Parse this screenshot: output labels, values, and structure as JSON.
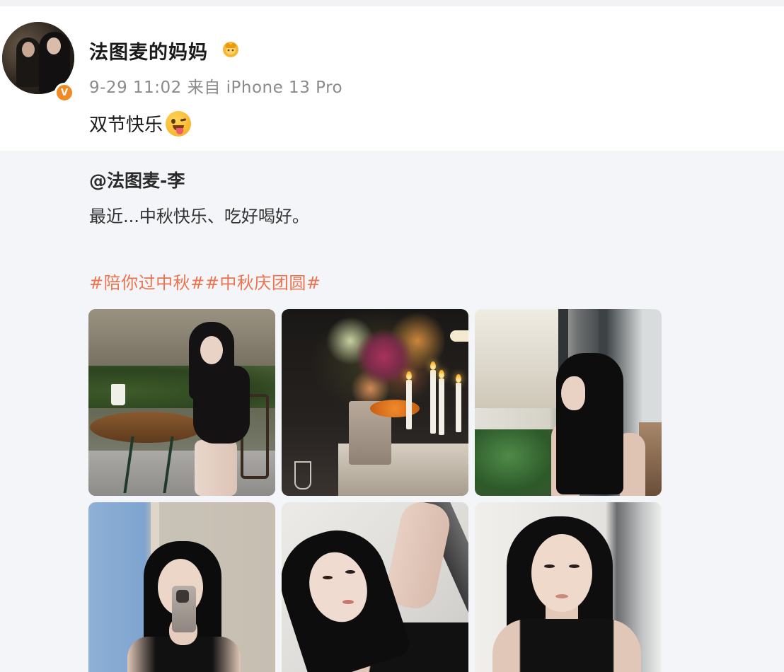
{
  "post": {
    "author_name": "法图麦的妈妈",
    "timestamp": "9-29 11:02",
    "source": "来自 iPhone 13 Pro",
    "text": "双节快乐",
    "emoji": "tongue-wink-emoji",
    "verified": true
  },
  "repost": {
    "author": "@法图麦-李",
    "text": "最近...中秋快乐、吃好喝好。",
    "hashtags": "#陪你过中秋##中秋庆团圆#"
  },
  "photos": [
    {
      "name": "photo-1",
      "description_icon": "image-icon"
    },
    {
      "name": "photo-2",
      "description_icon": "image-icon"
    },
    {
      "name": "photo-3",
      "description_icon": "image-icon"
    },
    {
      "name": "photo-4",
      "description_icon": "image-icon"
    },
    {
      "name": "photo-5",
      "description_icon": "image-icon"
    },
    {
      "name": "photo-6",
      "description_icon": "image-icon"
    }
  ],
  "colors": {
    "background": "#ffffff",
    "repost_background": "#f4f5f8",
    "hashtag": "#eb7350",
    "meta_text": "#8a8a8a",
    "verified_badge": "#f08a24"
  }
}
